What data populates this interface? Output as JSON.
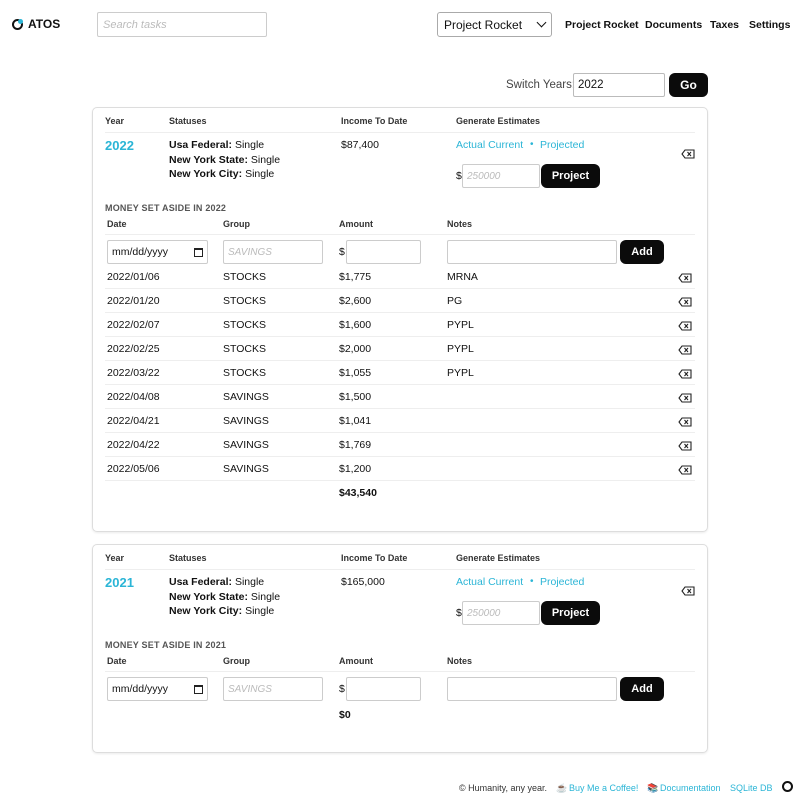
{
  "app": {
    "name": "ATOS"
  },
  "header": {
    "search_placeholder": "Search tasks",
    "project_selected": "Project Rocket",
    "nav": [
      "Project Rocket",
      "Documents",
      "Taxes",
      "Settings"
    ]
  },
  "switch_years": {
    "label": "Switch Years:",
    "value": "2022",
    "go_label": "Go"
  },
  "columns": {
    "year": "Year",
    "statuses": "Statuses",
    "income": "Income To Date",
    "estimates": "Generate Estimates",
    "date": "Date",
    "group": "Group",
    "amount": "Amount",
    "notes": "Notes"
  },
  "labels": {
    "actual_current": "Actual Current",
    "projected": "Projected",
    "dot": "•",
    "dollar": "$",
    "estimate_placeholder": "250000",
    "project_button": "Project",
    "date_placeholder": "mm/dd/yyyy",
    "group_placeholder": "SAVINGS",
    "add_button": "Add"
  },
  "cards": [
    {
      "year": "2022",
      "statuses": [
        {
          "label": "Usa Federal:",
          "value": "Single"
        },
        {
          "label": "New York State:",
          "value": "Single"
        },
        {
          "label": "New York City:",
          "value": "Single"
        }
      ],
      "income": "$87,400",
      "section_title": "MONEY SET ASIDE IN 2022",
      "rows": [
        {
          "date": "2022/01/06",
          "group": "STOCKS",
          "amount": "$1,775",
          "notes": "MRNA"
        },
        {
          "date": "2022/01/20",
          "group": "STOCKS",
          "amount": "$2,600",
          "notes": "PG"
        },
        {
          "date": "2022/02/07",
          "group": "STOCKS",
          "amount": "$1,600",
          "notes": "PYPL"
        },
        {
          "date": "2022/02/25",
          "group": "STOCKS",
          "amount": "$2,000",
          "notes": "PYPL"
        },
        {
          "date": "2022/03/22",
          "group": "STOCKS",
          "amount": "$1,055",
          "notes": "PYPL"
        },
        {
          "date": "2022/04/08",
          "group": "SAVINGS",
          "amount": "$1,500",
          "notes": ""
        },
        {
          "date": "2022/04/21",
          "group": "SAVINGS",
          "amount": "$1,041",
          "notes": ""
        },
        {
          "date": "2022/04/22",
          "group": "SAVINGS",
          "amount": "$1,769",
          "notes": ""
        },
        {
          "date": "2022/05/06",
          "group": "SAVINGS",
          "amount": "$1,200",
          "notes": ""
        }
      ],
      "total": "$43,540"
    },
    {
      "year": "2021",
      "statuses": [
        {
          "label": "Usa Federal:",
          "value": "Single"
        },
        {
          "label": "New York State:",
          "value": "Single"
        },
        {
          "label": "New York City:",
          "value": "Single"
        }
      ],
      "income": "$165,000",
      "section_title": "MONEY SET ASIDE IN 2021",
      "rows": [],
      "total": "$0"
    }
  ],
  "footer": {
    "copyright": "© Humanity, any year.",
    "coffee": "Buy Me a Coffee!",
    "docs": "Documentation",
    "db": "SQLite DB"
  },
  "colors": {
    "accent": "#2bb5d6",
    "button": "#0b0b0b"
  }
}
